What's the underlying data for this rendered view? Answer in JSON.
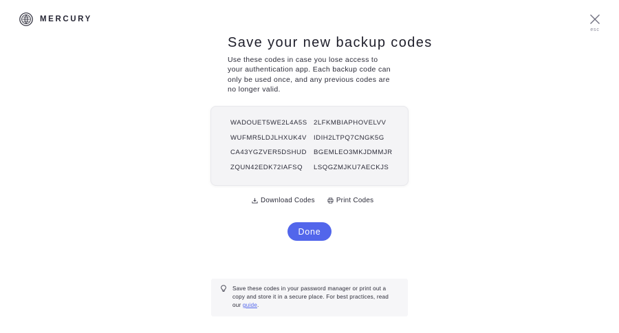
{
  "brand": {
    "name": "MERCURY",
    "logo_icon": "mercury-logo"
  },
  "close": {
    "icon": "close-icon",
    "label": "esc"
  },
  "dialog": {
    "title": "Save your new backup codes",
    "description": "Use these codes in case you lose access to your authentication app. Each backup code can only be used once, and any previous codes are no longer valid.",
    "codes": [
      "WADOUET5WE2L4A5S",
      "2LFKMBIAPHOVELVV",
      "WUFMR5LDJLHXUK4V",
      "IDIH2LTPQ7CNGK5G",
      "CA43YGZVER5DSHUD",
      "BGEMLEO3MKJDMMJR",
      "ZQUN42EDK72IAFSQ",
      "LSQGZMJKU7AECKJS"
    ],
    "actions": {
      "download_label": "Download Codes",
      "download_icon": "download-icon",
      "print_label": "Print Codes",
      "print_icon": "printer-icon"
    },
    "done_label": "Done"
  },
  "tip": {
    "icon": "lightbulb-icon",
    "text_before": "Save these codes in your password manager or print out a copy and store it in a secure place. For best practices, read our ",
    "link_text": "guide",
    "text_after": "."
  },
  "colors": {
    "accent": "#5266eb",
    "text": "#272735",
    "codes_bg": "#f4f4f6",
    "tip_bg": "#f6f6f8"
  }
}
